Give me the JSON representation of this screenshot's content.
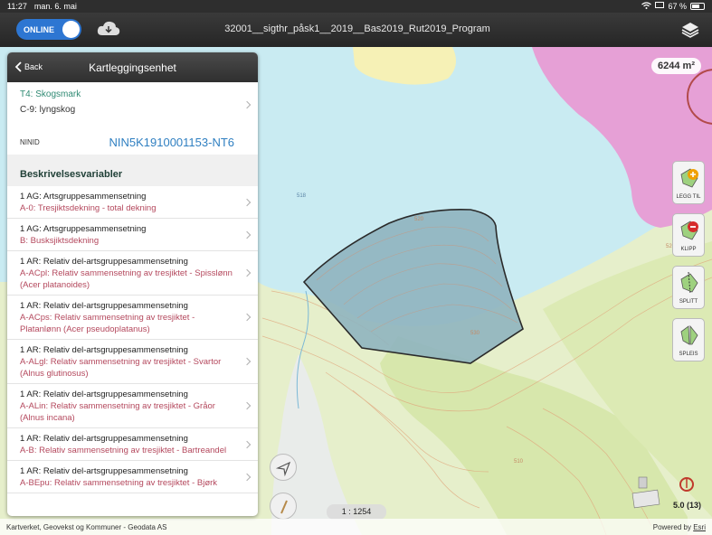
{
  "status_bar": {
    "time": "11:27",
    "date": "man. 6. mai",
    "battery": "67 %"
  },
  "nav_bar": {
    "online_label": "ONLINE",
    "title": "32001__sigthr_påsk1__2019__Bas2019_Rut2019_Program"
  },
  "panel": {
    "back_label": "Back",
    "title": "Kartleggingsenhet",
    "type_main": "T4: Skogsmark",
    "type_sub": "C-9: lyngskog",
    "ninid_label": "NINID",
    "ninid_value": "NIN5K1910001153-NT6",
    "section_title": "Beskrivelsesvariabler",
    "items": [
      {
        "title": "1 AG: Artsgruppesammensetning",
        "value": "A-0: Tresjiktsdekning - total dekning"
      },
      {
        "title": "1 AG: Artsgruppesammensetning",
        "value": "B: Busksjiktsdekning"
      },
      {
        "title": "1 AR: Relativ del-artsgruppesammensetning",
        "value": "A-ACpl: Relativ sammensetning av tresjiktet - Spisslønn (Acer platanoides)"
      },
      {
        "title": "1 AR: Relativ del-artsgruppesammensetning",
        "value": "A-ACps: Relativ sammensetning av tresjiktet - Platanlønn (Acer pseudoplatanus)"
      },
      {
        "title": "1 AR: Relativ del-artsgruppesammensetning",
        "value": "A-ALgl: Relativ sammensetning av tresjiktet - Svartor (Alnus glutinosus)"
      },
      {
        "title": "1 AR: Relativ del-artsgruppesammensetning",
        "value": "A-ALin: Relativ sammensetning av tresjiktet - Gråor (Alnus incana)"
      },
      {
        "title": "1 AR: Relativ del-artsgruppesammensetning",
        "value": "A-B: Relativ sammensetning av tresjiktet - Bartreandel"
      },
      {
        "title": "1 AR: Relativ del-artsgruppesammensetning",
        "value": "A-BEpu: Relativ sammensetning av tresjiktet - Bjørk"
      }
    ]
  },
  "map": {
    "area_badge": "6244 m²",
    "tools": [
      {
        "label": "LEGG TIL",
        "icon": "add-polygon-icon"
      },
      {
        "label": "KLIPP",
        "icon": "cut-polygon-icon"
      },
      {
        "label": "SPLITT",
        "icon": "split-polygon-icon"
      },
      {
        "label": "SPLEIS",
        "icon": "merge-polygon-icon"
      }
    ],
    "scale": "1 : 1254",
    "gps_accuracy": "5.0 (13)",
    "contour_labels": [
      "518",
      "520",
      "530",
      "520",
      "510"
    ],
    "attribution": "Kartverket, Geovekst og Kommuner - Geodata AS",
    "powered_by": "Powered by",
    "powered_by_brand": "Esri",
    "colors": {
      "water": "#c9ebf2",
      "land": "#e7efcc",
      "forest": "#d6e6a7",
      "pink": "#e7a1d6",
      "yellow": "#f7f2b7",
      "polygon": "#8fb4bf"
    }
  }
}
